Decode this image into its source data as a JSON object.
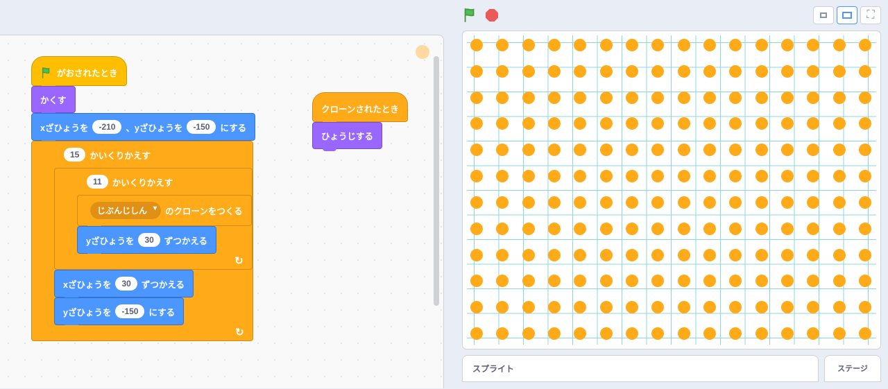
{
  "stage_header": {
    "green_flag_alt": "green-flag",
    "stop_alt": "stop"
  },
  "sprite_panel": {
    "label_sprite": "スプライト",
    "label_stage": "ステージ"
  },
  "script1": {
    "hat_label": "がおされたとき",
    "hide_label": "かくす",
    "goto_prefix": "xざひょうを",
    "goto_x": "-210",
    "goto_mid": "、yざひょうを",
    "goto_y": "-150",
    "goto_suffix": "にする",
    "repeat1_n": "15",
    "repeat_suffix": "かいくりかえす",
    "repeat2_n": "11",
    "clone_dropdown": "じぶんじしん",
    "clone_suffix": "のクローンをつくる",
    "changey_prefix": "yざひょうを",
    "changey_n": "30",
    "changey_suffix": "ずつかえる",
    "changex_prefix": "xざひょうを",
    "changex_n": "30",
    "changex_suffix": "ずつかえる",
    "sety_prefix": "yざひょうを",
    "sety_n": "-150",
    "sety_suffix": "にする"
  },
  "script2": {
    "hat_label": "クローンされたとき",
    "show_label": "ひょうじする"
  },
  "stage_grid": {
    "cols": 16,
    "rows": 12
  }
}
